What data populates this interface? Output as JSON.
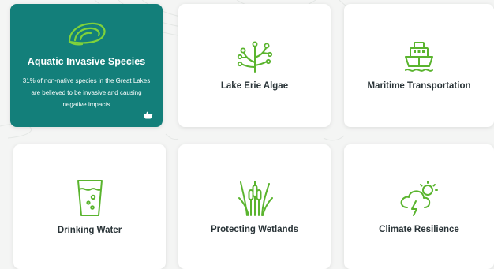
{
  "colors": {
    "accent": "#137f7a",
    "icon_green": "#5ab42e",
    "title_text": "#2a3438",
    "background": "#f4f5f4"
  },
  "cards": [
    {
      "title": "Aquatic Invasive Species",
      "description": "31% of non-native species in the Great Lakes are believed to be invasive and causing negative impacts",
      "icon": "mussel-shell-icon",
      "active": true
    },
    {
      "title": "Lake Erie Algae",
      "icon": "algae-icon",
      "active": false
    },
    {
      "title": "Maritime Transportation",
      "icon": "ship-icon",
      "active": false
    },
    {
      "title": "Drinking Water",
      "icon": "water-glass-icon",
      "active": false
    },
    {
      "title": "Protecting Wetlands",
      "icon": "cattail-icon",
      "active": false
    },
    {
      "title": "Climate Resilience",
      "icon": "storm-cloud-icon",
      "active": false
    }
  ]
}
